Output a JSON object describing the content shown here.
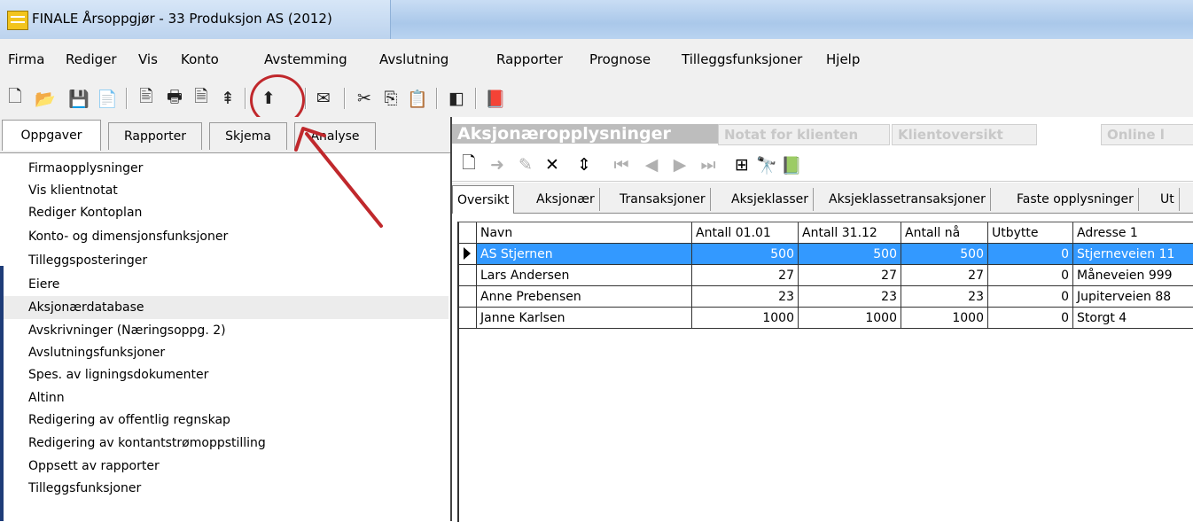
{
  "window": {
    "title": "FINALE Årsoppgjør - 33 Produksjon AS (2012)"
  },
  "menu": [
    "Firma",
    "Rediger",
    "Vis",
    "Konto",
    "Avstemming",
    "Avslutning",
    "Rapporter",
    "Prognose",
    "Tilleggsfunksjoner",
    "Hjelp"
  ],
  "toolbar": {
    "icons": [
      "new-document-icon",
      "open-folder-icon",
      "save-icon",
      "open-icon",
      "print-preview-icon",
      "print-icon",
      "preview-icon",
      "import-icon",
      "mail-icon",
      "cut-icon",
      "copy-icon",
      "paste-icon",
      "panel-icon",
      "book-icon"
    ]
  },
  "left_tabs": [
    "Oppgaver",
    "Rapporter",
    "Skjema",
    "Analyse"
  ],
  "tasks": [
    "Firmaopplysninger",
    "Vis klientnotat",
    "Rediger Kontoplan",
    "Konto- og dimensjonsfunksjoner",
    "Tilleggsposteringer",
    "Eiere",
    "Aksjonærdatabase",
    "Avskrivninger (Næringsoppg. 2)",
    "Avslutningsfunksjoner",
    "Spes. av ligningsdokumenter",
    "Altinn",
    "Redigering av offentlig regnskap",
    "Redigering av kontantstrømoppstilling",
    "Oppsett av rapporter",
    "Tilleggsfunksjoner"
  ],
  "selected_task": "Aksjonærdatabase",
  "right_tabs": [
    "Aksjonæropplysninger",
    "Notat for klienten",
    "Klientoversikt",
    "Online l"
  ],
  "sub_tabs": [
    "Oversikt",
    "Aksjonær",
    "Transaksjoner",
    "Aksjeklasser",
    "Aksjeklassetransaksjoner",
    "Faste opplysninger",
    "Ut"
  ],
  "grid": {
    "columns": [
      "Navn",
      "Antall 01.01",
      "Antall 31.12",
      "Antall nå",
      "Utbytte",
      "Adresse 1"
    ],
    "rows": [
      [
        "AS Stjernen",
        "500",
        "500",
        "500",
        "0",
        "Stjerneveien 11"
      ],
      [
        "Lars Andersen",
        "27",
        "27",
        "27",
        "0",
        "Måneveien 999"
      ],
      [
        "Anne Prebensen",
        "23",
        "23",
        "23",
        "0",
        "Jupiterveien 88"
      ],
      [
        "Janne Karlsen",
        "1000",
        "1000",
        "1000",
        "0",
        "Storgt 4"
      ]
    ],
    "selected_row": 0
  },
  "colors": {
    "selection": "#3399ff",
    "highlight_circle": "#c0282c"
  }
}
